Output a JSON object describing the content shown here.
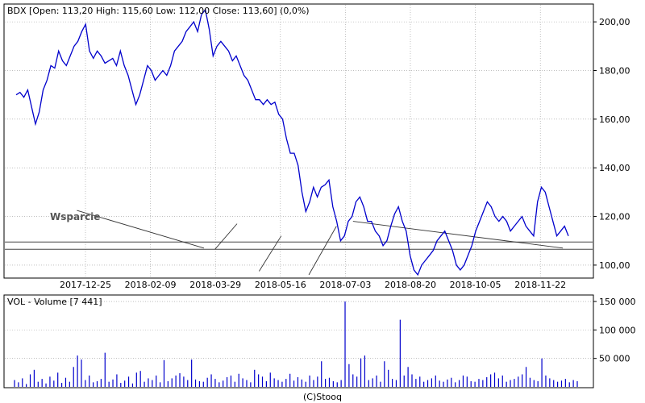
{
  "chart_data": [
    {
      "type": "line",
      "ticker": "BDX",
      "header": "BDX [Open: 113,20  High: 115,60  Low: 112,00  Close: 113,60] (0,0%)",
      "annotation": "Wsparcie",
      "ylim": [
        95,
        207
      ],
      "y_ticks": [
        100,
        120,
        140,
        160,
        180,
        200
      ],
      "y_tick_labels": [
        "100,00",
        "120,00",
        "140,00",
        "160,00",
        "180,00",
        "200,00"
      ],
      "x_tick_labels": [
        "2017-12-25",
        "2018-02-09",
        "2018-03-29",
        "2018-05-16",
        "2018-07-03",
        "2018-08-20",
        "2018-10-05",
        "2018-11-22"
      ],
      "grid": true,
      "line_color": "#0000cc",
      "support_lines": [
        109.5,
        106.5
      ],
      "series": [
        {
          "values": [
            170,
            171,
            169,
            172,
            165,
            158,
            163,
            172,
            176,
            182,
            181,
            188,
            184,
            182,
            186,
            190,
            192,
            196,
            199,
            188,
            185,
            188,
            186,
            183,
            184,
            185,
            182,
            188,
            182,
            178,
            172,
            166,
            170,
            176,
            182,
            180,
            176,
            178,
            180,
            178,
            182,
            188,
            190,
            192,
            196,
            198,
            200,
            196,
            203,
            205,
            197,
            186,
            190,
            192,
            190,
            188,
            184,
            186,
            182,
            178,
            176,
            172,
            168,
            168,
            166,
            168,
            166,
            167,
            162,
            160,
            152,
            146,
            146,
            141,
            130,
            122,
            126,
            132,
            128,
            132,
            133,
            135,
            124,
            118,
            110,
            112,
            118,
            120,
            126,
            128,
            124,
            118,
            118,
            114,
            112,
            108,
            110,
            116,
            121,
            124,
            118,
            114,
            104,
            98,
            96,
            100,
            102,
            104,
            106,
            110,
            112,
            114,
            110,
            106,
            100,
            98,
            100,
            104,
            108,
            114,
            118,
            122,
            126,
            124,
            120,
            118,
            120,
            118,
            114,
            116,
            118,
            120,
            116,
            114,
            112,
            126,
            132,
            130,
            124,
            118,
            112,
            114,
            116,
            112
          ]
        }
      ],
      "trend_lines": [
        [
          [
            0.11,
            122.5
          ],
          [
            0.34,
            107.0
          ]
        ],
        [
          [
            0.36,
            106.5
          ],
          [
            0.4,
            117.0
          ]
        ],
        [
          [
            0.44,
            97.5
          ],
          [
            0.48,
            112.0
          ]
        ],
        [
          [
            0.53,
            96.0
          ],
          [
            0.58,
            116.0
          ]
        ],
        [
          [
            0.61,
            118.0
          ],
          [
            0.99,
            107.0
          ]
        ]
      ]
    },
    {
      "type": "bar",
      "title": "VOL - Volume [7 441]",
      "ylim": [
        0,
        160000
      ],
      "y_ticks": [
        50000,
        100000,
        150000
      ],
      "y_tick_labels": [
        "50 000",
        "100 000",
        "150 000"
      ],
      "bar_color": "#0000cc",
      "values": [
        12000,
        8000,
        15000,
        5000,
        22000,
        30000,
        9000,
        14000,
        6000,
        18000,
        11000,
        25000,
        7000,
        16000,
        9000,
        35000,
        55000,
        48000,
        12000,
        20000,
        8000,
        10000,
        14000,
        60000,
        9000,
        13000,
        22000,
        7000,
        11000,
        18000,
        6000,
        25000,
        28000,
        9000,
        15000,
        12000,
        20000,
        8000,
        47000,
        10000,
        15000,
        20000,
        24000,
        18000,
        12000,
        48000,
        13000,
        10000,
        9000,
        16000,
        22000,
        14000,
        8000,
        11000,
        17000,
        20000,
        9000,
        23000,
        15000,
        12000,
        8000,
        30000,
        22000,
        18000,
        10000,
        25000,
        15000,
        12000,
        9000,
        14000,
        23000,
        11000,
        17000,
        13000,
        9000,
        20000,
        12000,
        18000,
        45000,
        14000,
        16000,
        10000,
        8000,
        12000,
        150000,
        40000,
        22000,
        18000,
        50000,
        55000,
        12000,
        15000,
        20000,
        9000,
        45000,
        30000,
        14000,
        12000,
        118000,
        20000,
        35000,
        22000,
        14000,
        18000,
        9000,
        12000,
        15000,
        20000,
        11000,
        9000,
        13000,
        16000,
        8000,
        12000,
        20000,
        18000,
        10000,
        9000,
        14000,
        12000,
        17000,
        22000,
        25000,
        15000,
        20000,
        9000,
        12000,
        14000,
        18000,
        22000,
        35000,
        16000,
        12000,
        10000,
        50000,
        20000,
        15000,
        12000,
        9000,
        11000,
        14000,
        8000,
        12000,
        10000
      ]
    }
  ],
  "footer": "(C)Stooq"
}
